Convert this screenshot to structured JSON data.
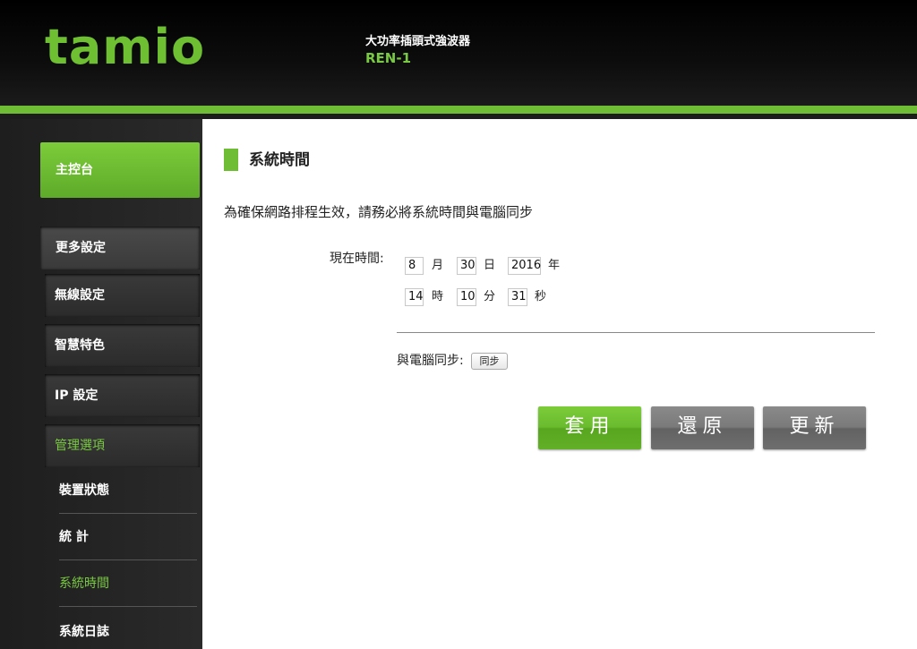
{
  "header": {
    "logo": "tamio",
    "product_title": "大功率插頭式強波器",
    "model": "REN-1"
  },
  "sidebar": {
    "main": "主控台",
    "more": "更多設定",
    "items": [
      "無線設定",
      "智慧特色",
      "IP 設定",
      "管理選項"
    ],
    "sub_items": [
      "裝置狀態",
      "統 計",
      "系統時間",
      "系統日誌"
    ]
  },
  "content": {
    "section_title": "系統時間",
    "description": "為確保網路排程生效，請務必將系統時間與電腦同步",
    "current_time_label": "現在時間:",
    "month": "8",
    "month_unit": "月",
    "day": "30",
    "day_unit": "日",
    "year": "2016",
    "year_unit": "年",
    "hour": "14",
    "hour_unit": "時",
    "minute": "10",
    "minute_unit": "分",
    "second": "31",
    "second_unit": "秒",
    "sync_label": "與電腦同步:",
    "sync_button": "同步",
    "apply_button": "套用",
    "revert_button": "還原",
    "refresh_button": "更新"
  },
  "colors": {
    "accent": "#6fbc35",
    "dark_bg": "#1a1a1a",
    "gray_button": "#707070"
  }
}
